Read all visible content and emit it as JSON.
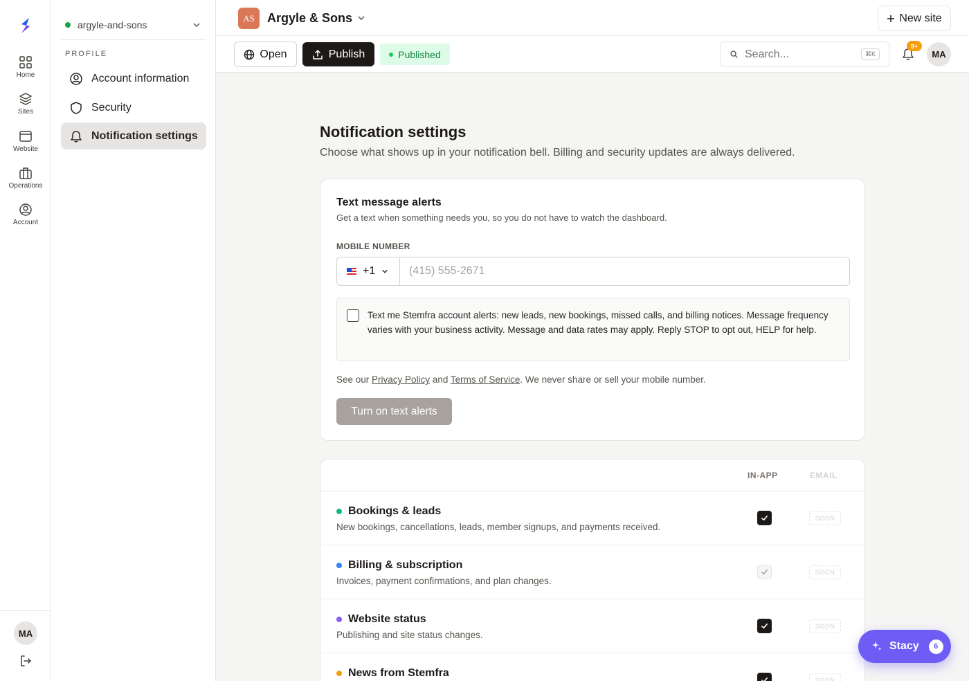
{
  "rail": {
    "items": [
      {
        "label": "Home",
        "icon": "grid-icon"
      },
      {
        "label": "Sites",
        "icon": "layers-icon"
      },
      {
        "label": "Website",
        "icon": "browser-icon"
      },
      {
        "label": "Operations",
        "icon": "briefcase-icon"
      },
      {
        "label": "Account",
        "icon": "user-circle-icon"
      }
    ],
    "avatar": "MA"
  },
  "subnav": {
    "site": "argyle-and-sons",
    "section_label": "PROFILE",
    "items": [
      {
        "label": "Account information",
        "icon": "user-circle-icon"
      },
      {
        "label": "Security",
        "icon": "shield-icon"
      },
      {
        "label": "Notification settings",
        "icon": "bell-icon",
        "active": true
      }
    ]
  },
  "topbar": {
    "brand_initials": "AS",
    "brand_name": "Argyle & Sons",
    "new_site_label": "New site"
  },
  "toolbar": {
    "open_label": "Open",
    "publish_label": "Publish",
    "status_label": "Published",
    "search_placeholder": "Search...",
    "search_shortcut": "⌘K",
    "notification_badge": "9+",
    "avatar": "MA"
  },
  "main": {
    "title": "Notification settings",
    "subtitle": "Choose what shows up in your notification bell. Billing and security updates are always delivered."
  },
  "text_alerts": {
    "title": "Text message alerts",
    "subtitle": "Get a text when something needs you, so you do not have to watch the dashboard.",
    "field_label": "MOBILE NUMBER",
    "country_code": "+1",
    "phone_placeholder": "(415) 555-2671",
    "phone_value": "",
    "consent_checked": false,
    "consent_text": "Text me Stemfra account alerts: new leads, new bookings, missed calls, and billing notices. Message frequency varies with your business activity. Message and data rates may apply. Reply STOP to opt out, HELP for help.",
    "policy_prefix": "See our ",
    "privacy_link": "Privacy Policy",
    "policy_and": " and ",
    "terms_link": "Terms of Service",
    "policy_suffix": ". We never share or sell your mobile number.",
    "button_label": "Turn on text alerts"
  },
  "prefs": {
    "col_inapp": "IN-APP",
    "col_email": "EMAIL",
    "soon_label": "SOON",
    "rows": [
      {
        "title": "Bookings & leads",
        "desc": "New bookings, cancellations, leads, member signups, and payments received.",
        "dot_color": "#10b981",
        "inapp": "on"
      },
      {
        "title": "Billing & subscription",
        "desc": "Invoices, payment confirmations, and plan changes.",
        "dot_color": "#3b82f6",
        "inapp": "locked"
      },
      {
        "title": "Website status",
        "desc": "Publishing and site status changes.",
        "dot_color": "#8b5cf6",
        "inapp": "on"
      },
      {
        "title": "News from Stemfra",
        "desc": "",
        "dot_color": "#f59e0b",
        "inapp": "on"
      }
    ]
  },
  "assistant": {
    "label": "Stacy",
    "count": "6"
  },
  "colors": {
    "accent": "#6d5df5",
    "primary": "#1c1917",
    "published_bg": "#dcfce7",
    "published_text": "#15803d",
    "brand_badge": "#d97757"
  }
}
